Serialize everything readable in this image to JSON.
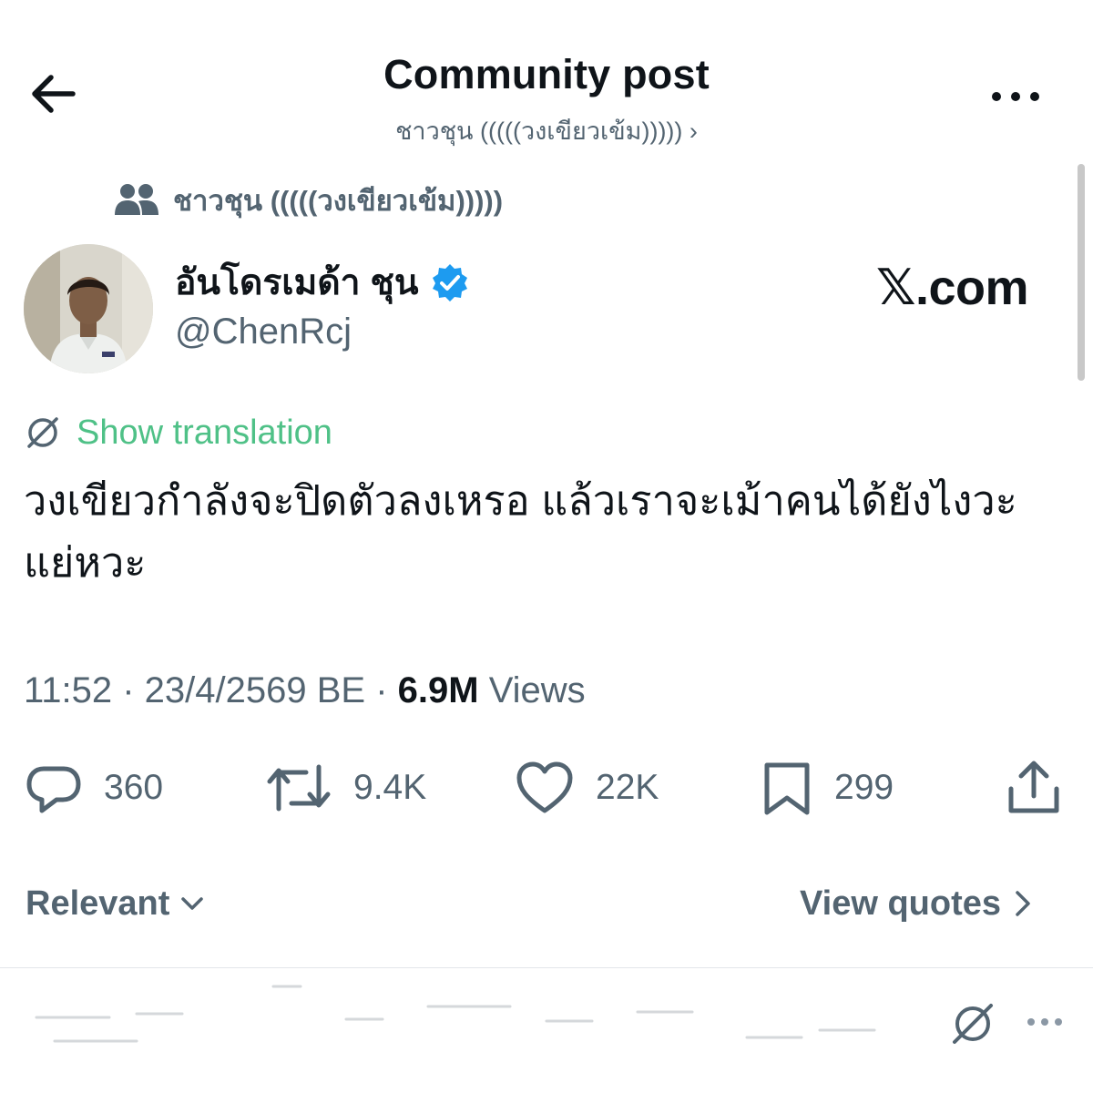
{
  "header": {
    "title": "Community post",
    "community_link": "ชาวชุน (((((วงเขียวเข้ม))))) ›"
  },
  "community": {
    "name": "ชาวชุน (((((วงเขียวเข้ม)))))",
    "icon": "people-icon"
  },
  "author": {
    "name": "อันโดรเมด้า ชุน",
    "handle": "@ChenRcj",
    "verified": true,
    "badge_color": "#1d9bf0"
  },
  "watermark": "𝕏.com",
  "translation": {
    "label": "Show translation",
    "icon": "translate-icon",
    "color": "#4fc187"
  },
  "post": {
    "text": "วงเขียวกำลังจะปิดตัวลงเหรอ แล้วเราจะเม้าคนได้ยังไงวะ แย่หวะ"
  },
  "meta": {
    "time_date": "11:52 · 23/4/2569 BE · ",
    "views_count": "6.9M",
    "views_label": " Views"
  },
  "actions": {
    "reply": {
      "count": "360",
      "icon": "reply-icon"
    },
    "repost": {
      "count": "9.4K",
      "icon": "repost-icon"
    },
    "like": {
      "count": "22K",
      "icon": "heart-icon"
    },
    "bookmark": {
      "count": "299",
      "icon": "bookmark-icon"
    },
    "share": {
      "icon": "share-icon"
    }
  },
  "replies": {
    "sort_label": "Relevant",
    "quotes_label": "View quotes"
  }
}
